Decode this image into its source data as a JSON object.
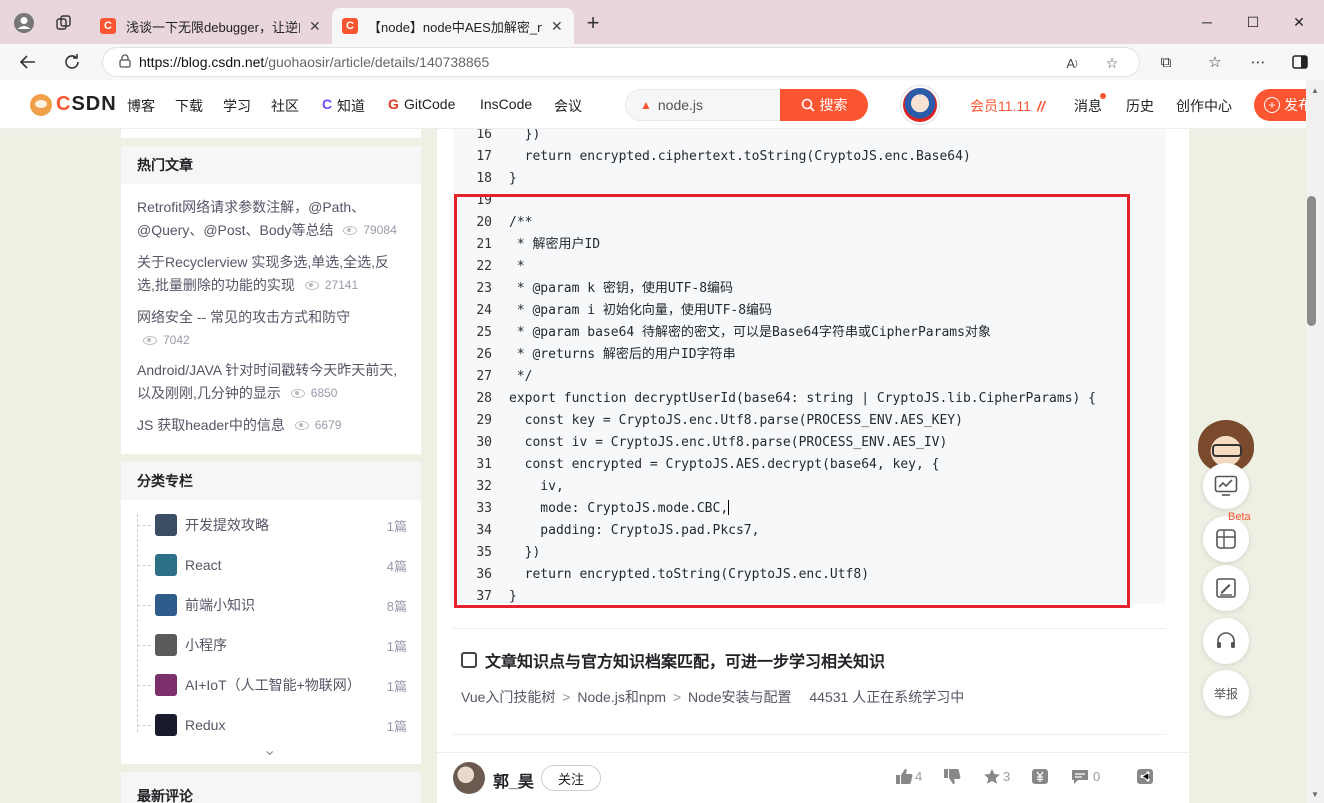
{
  "browser": {
    "tabs": [
      {
        "favicon": "C",
        "title": "浅谈一下无限debugger，让逆向都"
      },
      {
        "favicon": "C",
        "title": "【node】node中AES加解密_node"
      }
    ],
    "url_host": "https://blog.csdn.net",
    "url_path": "/guohaosir/article/details/140738865",
    "window_buttons": {
      "min": "─",
      "max": "☐",
      "close": "✕"
    }
  },
  "csdn": {
    "logo_c": "C",
    "logo_text": "SDN",
    "nav": [
      "博客",
      "下载",
      "学习",
      "社区",
      "知道",
      "GitCode",
      "InsCode",
      "会议"
    ],
    "search_value": "node.js",
    "search_button": "搜索",
    "vip": "会员11.11",
    "vip_mark": "//",
    "right_links": [
      "消息",
      "历史",
      "创作中心"
    ],
    "publish": "发布"
  },
  "sidebar": {
    "hot_title": "热门文章",
    "hot": [
      {
        "title": "Retrofit网络请求参数注解，@Path、@Query、@Post、Body等总结",
        "views": "79084"
      },
      {
        "title": "关于Recyclerview 实现多选,单选,全选,反选,批量删除的功能的实现",
        "views": "27141"
      },
      {
        "title": "网络安全 -- 常见的攻击方式和防守",
        "views": "7042"
      },
      {
        "title": "Android/JAVA 针对时间戳转今天昨天前天,以及刚刚,几分钟的显示",
        "views": "6850"
      },
      {
        "title": "JS 获取header中的信息",
        "views": "6679"
      }
    ],
    "columns_title": "分类专栏",
    "columns": [
      {
        "name": "开发提效攻略",
        "count": "1篇",
        "color": "#3b4d63"
      },
      {
        "name": "React",
        "count": "4篇",
        "color": "#2d6f86"
      },
      {
        "name": "前端小知识",
        "count": "8篇",
        "color": "#2f5c8a"
      },
      {
        "name": "小程序",
        "count": "1篇",
        "color": "#5a5a5a"
      },
      {
        "name": "AI+IoT（人工智能+物联网）",
        "count": "1篇",
        "color": "#7b2f6b"
      },
      {
        "name": "Redux",
        "count": "1篇",
        "color": "#1b1b2e"
      }
    ],
    "expand_icon": "⌄",
    "latest_title": "最新评论"
  },
  "code": [
    {
      "n": "16",
      "t": "  })"
    },
    {
      "n": "17",
      "t": "  return encrypted.ciphertext.toString(CryptoJS.enc.Base64)"
    },
    {
      "n": "18",
      "t": "}"
    },
    {
      "n": "19",
      "t": ""
    },
    {
      "n": "20",
      "t": "/**"
    },
    {
      "n": "21",
      "t": " * 解密用户ID"
    },
    {
      "n": "22",
      "t": " *"
    },
    {
      "n": "23",
      "t": " * @param k 密钥，使用UTF-8编码"
    },
    {
      "n": "24",
      "t": " * @param i 初始化向量，使用UTF-8编码"
    },
    {
      "n": "25",
      "t": " * @param base64 待解密的密文，可以是Base64字符串或CipherParams对象"
    },
    {
      "n": "26",
      "t": " * @returns 解密后的用户ID字符串"
    },
    {
      "n": "27",
      "t": " */"
    },
    {
      "n": "28",
      "t": "export function decryptUserId(base64: string | CryptoJS.lib.CipherParams) {"
    },
    {
      "n": "29",
      "t": "  const key = CryptoJS.enc.Utf8.parse(PROCESS_ENV.AES_KEY)"
    },
    {
      "n": "30",
      "t": "  const iv = CryptoJS.enc.Utf8.parse(PROCESS_ENV.AES_IV)"
    },
    {
      "n": "31",
      "t": "  const encrypted = CryptoJS.AES.decrypt(base64, key, {"
    },
    {
      "n": "32",
      "t": "    iv,"
    },
    {
      "n": "33",
      "t": "    mode: CryptoJS.mode.CBC,"
    },
    {
      "n": "34",
      "t": "    padding: CryptoJS.pad.Pkcs7,"
    },
    {
      "n": "35",
      "t": "  })"
    },
    {
      "n": "36",
      "t": "  return encrypted.toString(CryptoJS.enc.Utf8)"
    },
    {
      "n": "37",
      "t": "}"
    }
  ],
  "knowledge": {
    "title": "文章知识点与官方知识档案匹配，可进一步学习相关知识",
    "path": [
      "Vue入门技能树",
      "Node.js和npm",
      "Node安装与配置"
    ],
    "sep": ">",
    "learners": "44531 人正在系统学习中"
  },
  "author": {
    "name": "郭_昊",
    "follow": "关注",
    "likes": "4",
    "stars": "3",
    "comments": "0"
  },
  "side_tools": {
    "beta": "Beta",
    "report": "举报"
  },
  "colors": {
    "brand": "#fc5531",
    "highlight_box": "#e2232b",
    "page_bg": "#eef0e4"
  }
}
